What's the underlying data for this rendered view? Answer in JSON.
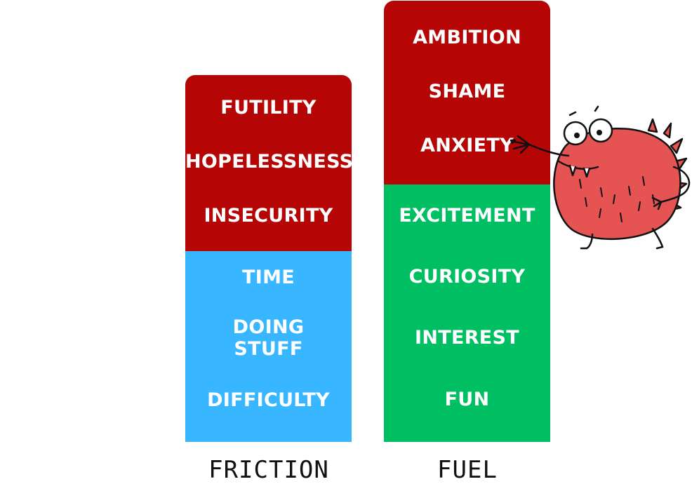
{
  "columns": [
    {
      "name": "FRICTION",
      "segments": [
        {
          "color": "#b50505",
          "labels": [
            "FUTILITY",
            "HOPELESSNESS",
            "INSECURITY"
          ]
        },
        {
          "color": "#38b6ff",
          "labels": [
            "TIME",
            "DOING\nSTUFF",
            "DIFFICULTY"
          ]
        }
      ]
    },
    {
      "name": "FUEL",
      "segments": [
        {
          "color": "#b50505",
          "labels": [
            "AMBITION",
            "SHAME",
            "ANXIETY"
          ]
        },
        {
          "color": "#00bf63",
          "labels": [
            "EXCITEMENT",
            "CURIOSITY",
            "INTEREST",
            "FUN"
          ]
        }
      ]
    }
  ],
  "monster_color": "#e55353"
}
